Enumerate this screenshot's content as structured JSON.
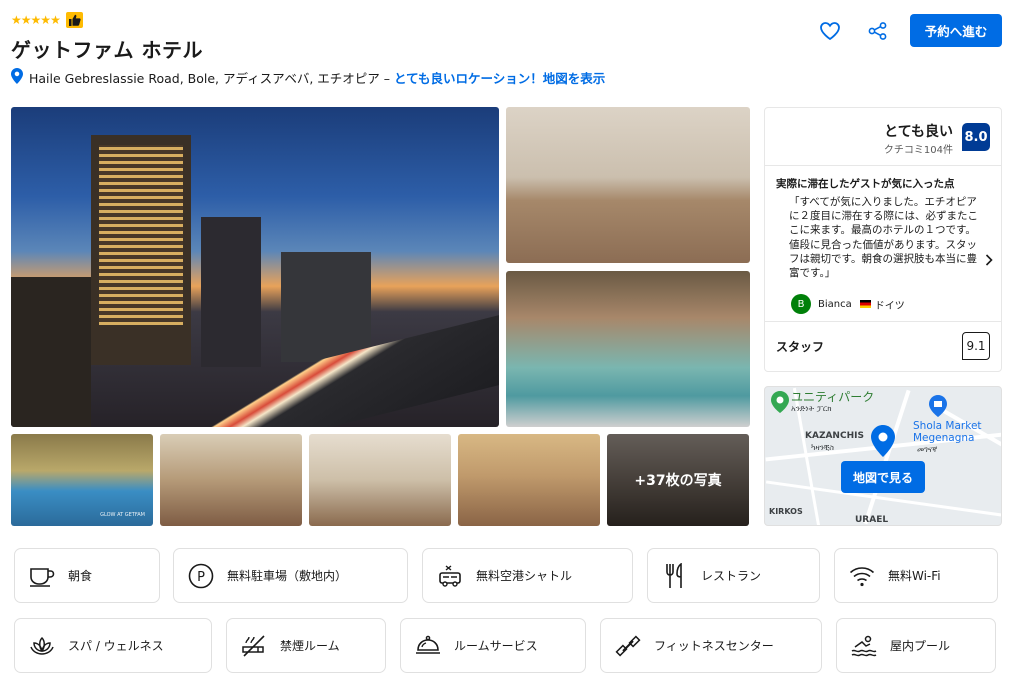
{
  "header": {
    "rating_stars": 5,
    "hotel_name": "ゲットファム ホテル",
    "address_text": "Haile Gebreslassie Road, Bole, アディスアベバ, エチオピア –",
    "location_link": "とても良いロケーション！地図を表示",
    "reserve_label": "予約へ進む",
    "icons": [
      "thumbs-up-icon",
      "heart-icon",
      "share-icon",
      "location-pin-icon"
    ]
  },
  "gallery": {
    "more_photos_label": "+37枚の写真",
    "main_photo_caption": "",
    "pool_photo_caption": "GLOW AT GETFAM"
  },
  "review": {
    "rating_word": "とても良い",
    "review_count": "クチコミ104件",
    "score": "8.0",
    "liked_heading": "実際に滞在したゲストが気に入った点",
    "quote": "「すべてが気に入りました。エチオピアに２度目に滞在する際には、必ずまたここに来ます。最高のホテルの１つです。値段に見合った価値があります。スタッフは親切です。朝食の選択肢も本当に豊富です。」",
    "author_initial": "B",
    "author_name": "Bianca",
    "author_country": "ドイツ",
    "staff_label": "スタッフ",
    "staff_score": "9.1"
  },
  "map": {
    "park_label": "ユニティパーク",
    "park_label_amharic": "አንድነት ፓርክ",
    "district_label": "KAZANCHIS",
    "district_label_amharic": "ካዛንቺስ",
    "market_label_1": "Shola Market",
    "market_label_2": "Megenagna",
    "market_label_amharic": "መገናኛ",
    "kirkos_label": "KIRKOS",
    "urael_label": "URAEL",
    "view_map_label": "地図で見る"
  },
  "amenities_row1": [
    {
      "label": "朝食",
      "icon": "coffee-cup-icon"
    },
    {
      "label": "無料駐車場（敷地内）",
      "icon": "parking-icon"
    },
    {
      "label": "無料空港シャトル",
      "icon": "shuttle-bus-icon"
    },
    {
      "label": "レストラン",
      "icon": "fork-knife-icon"
    },
    {
      "label": "無料Wi-Fi",
      "icon": "wifi-icon"
    }
  ],
  "amenities_row2": [
    {
      "label": "スパ / ウェルネス",
      "icon": "lotus-icon"
    },
    {
      "label": "禁煙ルーム",
      "icon": "no-smoking-icon"
    },
    {
      "label": "ルームサービス",
      "icon": "room-service-icon"
    },
    {
      "label": "フィットネスセンター",
      "icon": "dumbbell-icon"
    },
    {
      "label": "屋内プール",
      "icon": "swimming-icon"
    }
  ],
  "colors": {
    "brand_blue": "#006ce4",
    "score_navy": "#003b95",
    "star_yellow": "#febb02"
  }
}
